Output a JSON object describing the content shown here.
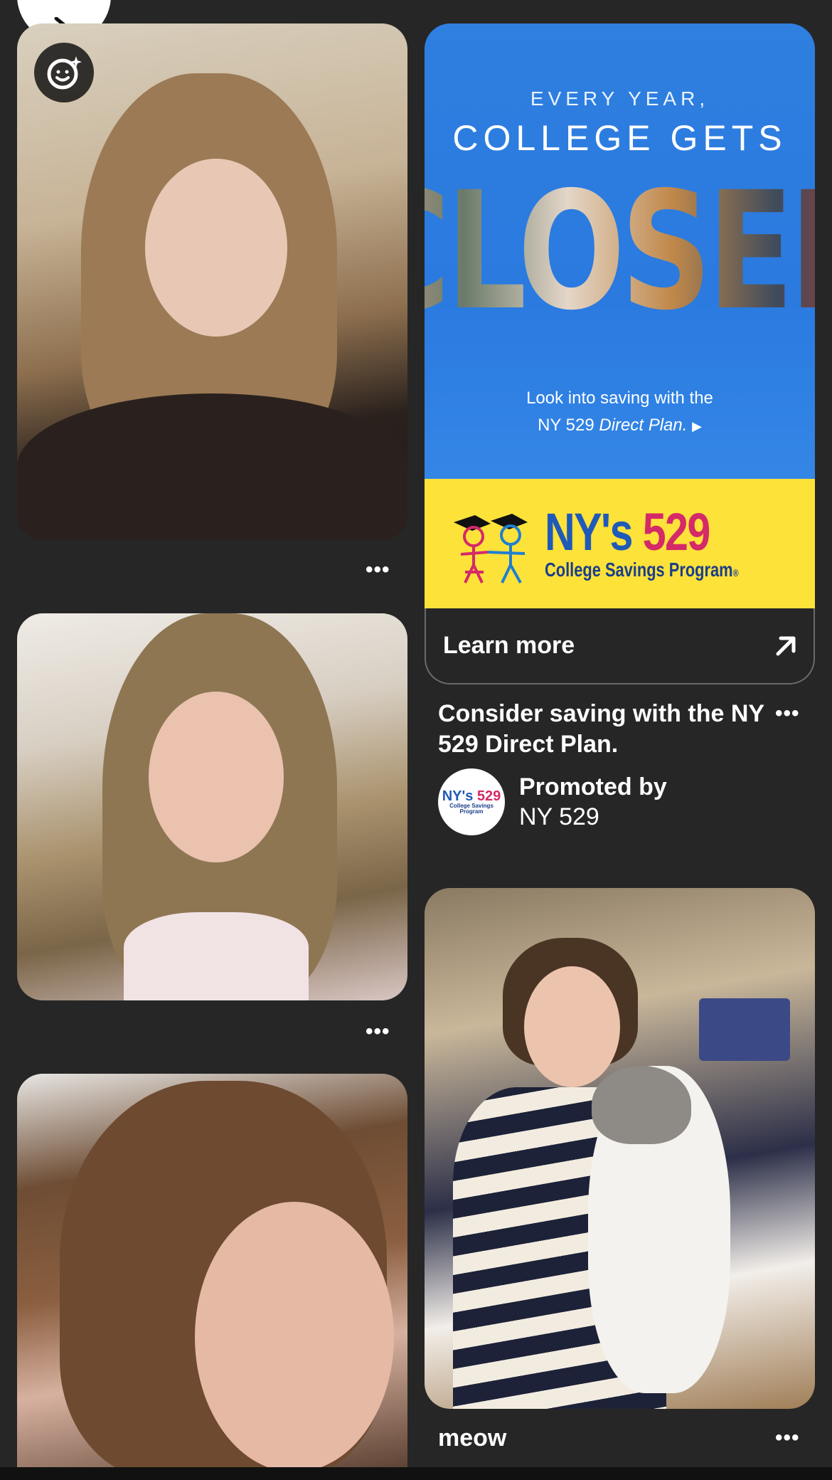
{
  "pins": {
    "left": [
      {
        "label": "selfie-girl-bangs-dark-sweater"
      },
      {
        "label": "selfie-girl-long-hair-necklace"
      },
      {
        "label": "selfie-girl-freckles-bangs"
      }
    ],
    "right_photo": {
      "title": "meow"
    }
  },
  "ad": {
    "line1": "EVERY YEAR,",
    "line2": "COLLEGE GETS",
    "headline": "CLOSER",
    "subtext_1": "Look into saving with the",
    "subtext_2_prefix": "NY 529 ",
    "subtext_2_italic": "Direct Plan.",
    "play_glyph": "▶",
    "logo_ny": "NY's",
    "logo_num": "529",
    "logo_sub": "College Savings Program",
    "logo_reg": "®",
    "cta": "Learn more",
    "title": "Consider saving with the NY 529 Direct Plan.",
    "promoted_by": "Promoted by",
    "advertiser": "NY 529",
    "avatar_ny": "NY's",
    "avatar_num": "529",
    "avatar_sub": "College Savings Program"
  },
  "more_glyph": "•••",
  "colors": {
    "background": "#262626",
    "ad_blue": "#2f7fe0",
    "ad_yellow": "#fde23a",
    "logo_blue": "#1f5ab8",
    "logo_pink": "#d42a68"
  },
  "icons": {
    "lens": "visual-search-icon",
    "back": "back-arrow-icon",
    "external": "external-arrow-icon",
    "more": "more-dots-icon"
  }
}
